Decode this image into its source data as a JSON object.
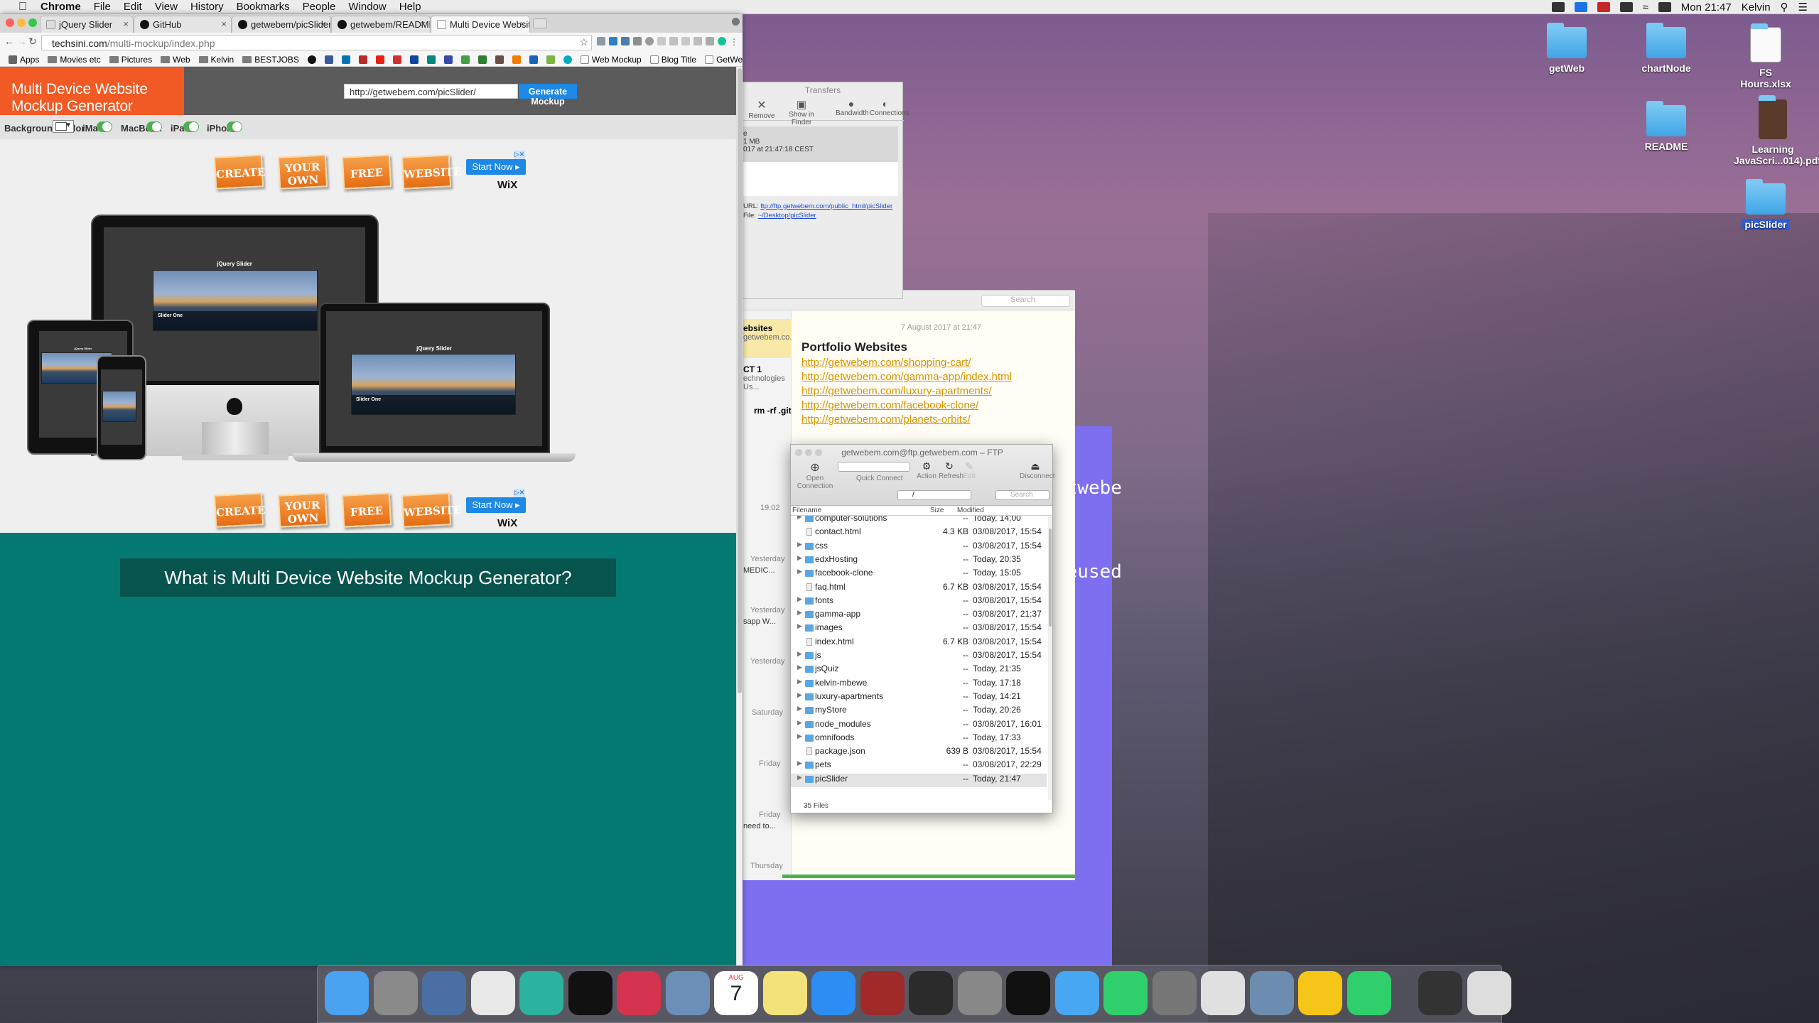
{
  "menubar": {
    "apple": "",
    "app": "Chrome",
    "items": [
      "File",
      "Edit",
      "View",
      "History",
      "Bookmarks",
      "People",
      "Window",
      "Help"
    ],
    "clock": "Mon 21:47",
    "user": "Kelvin"
  },
  "chrome": {
    "tabs": [
      {
        "label": "jQuery Slider"
      },
      {
        "label": "GitHub"
      },
      {
        "label": "getwebem/picSlider: An app t"
      },
      {
        "label": "getwebem/README: Folders f"
      },
      {
        "label": "Multi Device Website Mockup"
      }
    ],
    "url_host": "techsini.com",
    "url_path": "/multi-mockup/index.php",
    "bookmarks": [
      "Apps",
      "Movies etc",
      "Pictures",
      "Web",
      "Kelvin",
      "BESTJOBS",
      "Web Mockup",
      "Blog Title",
      "GetWeb Studio"
    ]
  },
  "page": {
    "logo": "Multi Device Website Mockup Generator",
    "url_value": "http://getwebem.com/picSlider/",
    "generate": "Generate Mockup",
    "bg_label": "Background Color",
    "devices": [
      "iMac",
      "MacBook",
      "iPad",
      "iPhone"
    ],
    "ad": {
      "signs": [
        "CREATE",
        "YOUR OWN",
        "FREE",
        "WEBSITE"
      ],
      "cta": "Start Now",
      "brand": "WiX"
    },
    "slider_title": "jQuery Slider",
    "slide_caption": "Slider One",
    "what": "What is Multi Device Website Mockup Generator?"
  },
  "desktop": {
    "icons": [
      "getWeb",
      "chartNode",
      "FS Hours.xlsx",
      "README",
      "Learning JavaScri...014).pdf",
      "picSlider"
    ]
  },
  "transfers": {
    "title": "Transfers",
    "buttons": [
      "Remove",
      "Show in Finder",
      "Bandwidth",
      "Connections"
    ],
    "size": "1 MB",
    "date": "017 at 21:47:18 CEST",
    "url_label": "URL:",
    "url": "ftp://ftp.getwebem.com/public_html/picSlider",
    "file_label": "File:",
    "file": "~/Desktop/picSlider"
  },
  "notes": {
    "date": "7 August 2017 at 21:47",
    "search": "Search",
    "list": [
      {
        "t": "ebsites",
        "s": "getwebem.co..."
      },
      {
        "t": "CT 1",
        "s": "echnologies Us..."
      },
      {
        "t": "rm -rf .git",
        "s": ""
      }
    ],
    "times": [
      "19:02",
      "Yesterday",
      "Yesterday",
      "Yesterday",
      "Saturday",
      "Friday",
      "Friday",
      "Thursday"
    ],
    "snips": [
      "MEDIC...",
      "sapp W...",
      "need to..."
    ],
    "title": "Portfolio Websites",
    "links": [
      "http://getwebem.com/shopping-cart/",
      "http://getwebem.com/gamma-app/index.html",
      "http://getwebem.com/luxury-apartments/",
      "http://getwebem.com/facebook-clone/",
      "http://getwebem.com/planets-orbits/"
    ]
  },
  "purple_text": [
    "etwebe",
    "reused"
  ],
  "ftp": {
    "title": "getwebem.com@ftp.getwebem.com – FTP",
    "toolbar": [
      "Open Connection",
      "Quick Connect",
      "Action",
      "Refresh",
      "Edit",
      "Disconnect"
    ],
    "path": "/",
    "search": "Search",
    "cols": [
      "Filename",
      "Size",
      "Modified"
    ],
    "rows": [
      {
        "n": "computer-solutions",
        "s": "--",
        "m": "Today, 14:00",
        "f": true
      },
      {
        "n": "contact.html",
        "s": "4.3 KB",
        "m": "03/08/2017, 15:54",
        "f": false
      },
      {
        "n": "css",
        "s": "--",
        "m": "03/08/2017, 15:54",
        "f": true
      },
      {
        "n": "edxHosting",
        "s": "--",
        "m": "Today, 20:35",
        "f": true
      },
      {
        "n": "facebook-clone",
        "s": "--",
        "m": "Today, 15:05",
        "f": true
      },
      {
        "n": "faq.html",
        "s": "6.7 KB",
        "m": "03/08/2017, 15:54",
        "f": false
      },
      {
        "n": "fonts",
        "s": "--",
        "m": "03/08/2017, 15:54",
        "f": true
      },
      {
        "n": "gamma-app",
        "s": "--",
        "m": "03/08/2017, 21:37",
        "f": true
      },
      {
        "n": "images",
        "s": "--",
        "m": "03/08/2017, 15:54",
        "f": true
      },
      {
        "n": "index.html",
        "s": "6.7 KB",
        "m": "03/08/2017, 15:54",
        "f": false
      },
      {
        "n": "js",
        "s": "--",
        "m": "03/08/2017, 15:54",
        "f": true
      },
      {
        "n": "jsQuiz",
        "s": "--",
        "m": "Today, 21:35",
        "f": true
      },
      {
        "n": "kelvin-mbewe",
        "s": "--",
        "m": "Today, 17:18",
        "f": true
      },
      {
        "n": "luxury-apartments",
        "s": "--",
        "m": "Today, 14:21",
        "f": true
      },
      {
        "n": "myStore",
        "s": "--",
        "m": "Today, 20:26",
        "f": true
      },
      {
        "n": "node_modules",
        "s": "--",
        "m": "03/08/2017, 16:01",
        "f": true
      },
      {
        "n": "omnifoods",
        "s": "--",
        "m": "Today, 17:33",
        "f": true
      },
      {
        "n": "package.json",
        "s": "639 B",
        "m": "03/08/2017, 15:54",
        "f": false
      },
      {
        "n": "pets",
        "s": "--",
        "m": "03/08/2017, 22:29",
        "f": true
      },
      {
        "n": "picSlider",
        "s": "--",
        "m": "Today, 21:47",
        "f": true
      }
    ],
    "footer": "35 Files"
  },
  "dock": {
    "items": [
      "finder-icon",
      "launchpad-icon",
      "mission-control-icon",
      "chrome-icon",
      "atom-icon",
      "brackets-icon",
      "airmail-icon",
      "preview-icon",
      "calendar-icon",
      "notes-icon",
      "app-store-icon",
      "dictionary-icon",
      "photo-booth-icon",
      "calculator-icon",
      "terminal-icon",
      "messages-icon",
      "whatsapp-icon",
      "system-preferences-icon",
      "photos-icon",
      "image-capture-icon",
      "cyberduck-icon",
      "whatsapp-icon",
      "activity-monitor-icon",
      "trash-icon"
    ],
    "calendar_month": "AUG",
    "calendar_day": "7"
  }
}
